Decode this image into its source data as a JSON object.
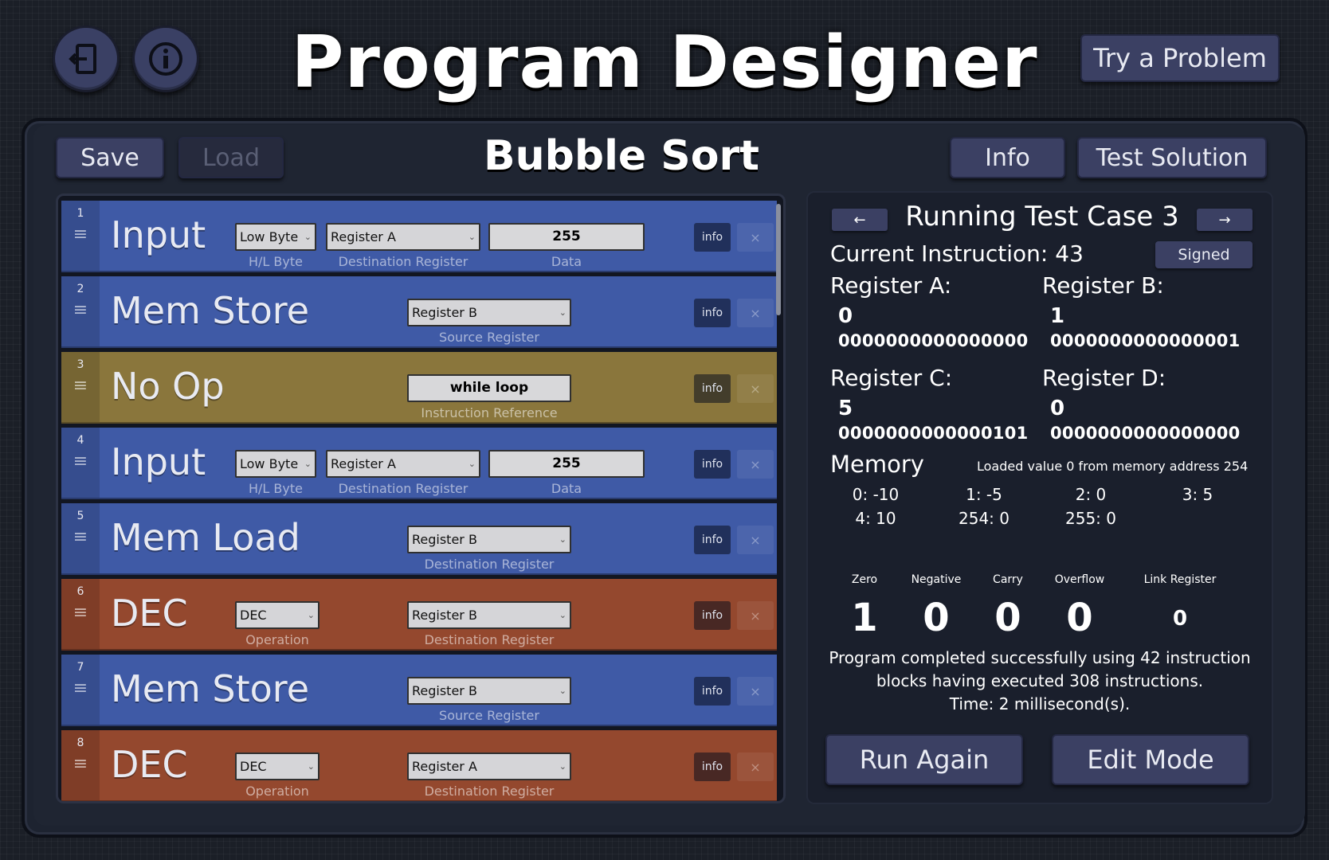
{
  "header": {
    "title": "Program Designer",
    "try_problem_label": "Try a Problem",
    "exit_icon": "exit-icon",
    "about_icon": "info-icon"
  },
  "toolbar": {
    "save_label": "Save",
    "load_label": "Load",
    "puzzle_title": "Bubble Sort",
    "info_label": "Info",
    "test_solution_label": "Test Solution"
  },
  "program": [
    {
      "num": "1",
      "name": "Input",
      "color": "#3f5aa6",
      "hl_byte": "Low Byte",
      "hl_label": "H/L Byte",
      "register": "Register A",
      "register_label": "Destination Register",
      "data": "255",
      "data_label": "Data",
      "info": "info",
      "delete": "×"
    },
    {
      "num": "2",
      "name": "Mem Store",
      "color": "#3f5aa6",
      "register": "Register B",
      "register_label": "Source Register",
      "info": "info",
      "delete": "×"
    },
    {
      "num": "3",
      "name": "No Op",
      "color": "#8a763c",
      "reference": "while loop",
      "reference_label": "Instruction Reference",
      "info": "info",
      "delete": "×"
    },
    {
      "num": "4",
      "name": "Input",
      "color": "#3f5aa6",
      "hl_byte": "Low Byte",
      "hl_label": "H/L Byte",
      "register": "Register A",
      "register_label": "Destination Register",
      "data": "255",
      "data_label": "Data",
      "info": "info",
      "delete": "×"
    },
    {
      "num": "5",
      "name": "Mem Load",
      "color": "#3f5aa6",
      "register": "Register B",
      "register_label": "Destination Register",
      "info": "info",
      "delete": "×"
    },
    {
      "num": "6",
      "name": "DEC",
      "color": "#94482e",
      "operation": "DEC",
      "operation_label": "Operation",
      "register": "Register B",
      "register_label": "Destination Register",
      "info": "info",
      "delete": "×"
    },
    {
      "num": "7",
      "name": "Mem Store",
      "color": "#3f5aa6",
      "register": "Register B",
      "register_label": "Source Register",
      "info": "info",
      "delete": "×"
    },
    {
      "num": "8",
      "name": "DEC",
      "color": "#94482e",
      "operation": "DEC",
      "operation_label": "Operation",
      "register": "Register A",
      "register_label": "Destination Register",
      "info": "info",
      "delete": "×"
    }
  ],
  "runner": {
    "prev_label": "←",
    "next_label": "→",
    "test_case_title": "Running Test Case 3",
    "current_instruction": "Current Instruction: 43",
    "signed_label": "Signed",
    "registers": [
      {
        "label": "Register A:",
        "value": "0",
        "binary": "0000000000000000"
      },
      {
        "label": "Register B:",
        "value": "1",
        "binary": "0000000000000001"
      },
      {
        "label": "Register C:",
        "value": "5",
        "binary": "0000000000000101"
      },
      {
        "label": "Register D:",
        "value": "0",
        "binary": "0000000000000000"
      }
    ],
    "memory_title": "Memory",
    "memory_message": "Loaded value 0 from memory address 254",
    "memory": [
      "0: -10",
      "1: -5",
      "2: 0",
      "3: 5",
      "4: 10",
      "254: 0",
      "255: 0"
    ],
    "flags": [
      {
        "label": "Zero",
        "value": "1"
      },
      {
        "label": "Negative",
        "value": "0"
      },
      {
        "label": "Carry",
        "value": "0"
      },
      {
        "label": "Overflow",
        "value": "0"
      }
    ],
    "link_register": {
      "label": "Link Register",
      "value": "0"
    },
    "status_lines": [
      "Program completed successfully using 42 instruction",
      "blocks having executed 308 instructions.",
      "Time: 2 millisecond(s)."
    ],
    "run_again_label": "Run Again",
    "edit_mode_label": "Edit Mode"
  }
}
